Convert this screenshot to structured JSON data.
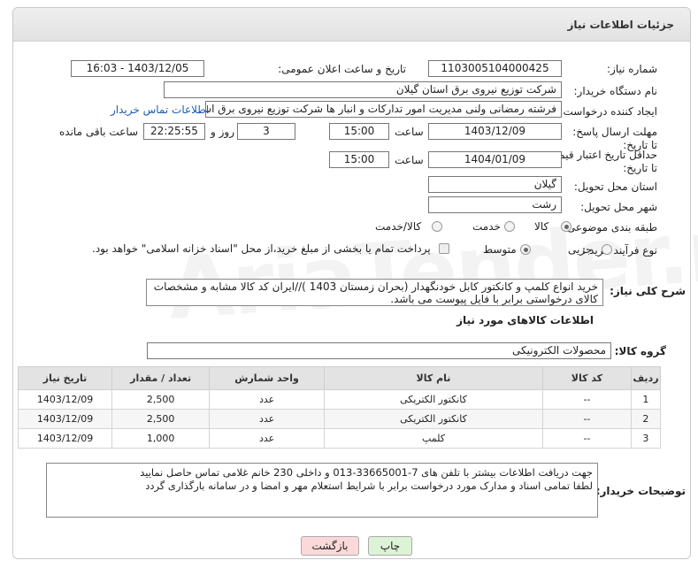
{
  "header": {
    "title": "جزئیات اطلاعات نیاز"
  },
  "form": {
    "need_number_label": "شماره نیاز:",
    "need_number": "1103005104000425",
    "announce_label": "تاریخ و ساعت اعلان عمومی:",
    "announce_value": "1403/12/05 - 16:03",
    "buyer_label": "نام دستگاه خریدار:",
    "buyer_value": "شرکت توزیع نیروی برق استان گیلان",
    "creator_label": "ایجاد کننده درخواست:",
    "creator_value": "فرشته رمضانی ولنی مدیریت امور تدارکات و انبار ها شرکت توزیع نیروی برق استان گیلان",
    "contact_link": "اطلاعات تماس خریدار",
    "deadline_label": "مهلت ارسال پاسخ: تا تاریخ:",
    "deadline_date": "1403/12/09",
    "time_label": "ساعت",
    "deadline_time": "15:00",
    "days_value": "3",
    "days_label": "روز و",
    "remaining_value": "22:25:55",
    "remaining_label": "ساعت باقی مانده",
    "validity_label": "حداقل تاریخ اعتبار قیمت: تا تاریخ:",
    "validity_date": "1404/01/09",
    "validity_time": "15:00",
    "province_label": "استان محل تحویل:",
    "province_value": "گیلان",
    "city_label": "شهر محل تحویل:",
    "city_value": "رشت",
    "category_label": "طبقه بندی موضوعی:",
    "category_options": [
      "کالا",
      "خدمت",
      "کالا/خدمت"
    ],
    "category_selected": "کالا",
    "process_label": "نوع فرآیند خرید :",
    "process_options": [
      "جزیی",
      "متوسط"
    ],
    "process_selected": "متوسط",
    "payment_note": "پرداخت تمام یا بخشی از مبلغ خرید،از محل \"اسناد خزانه اسلامی\" خواهد بود."
  },
  "description": {
    "label": "شرح کلی نیاز:",
    "text": "خرید انواع کلمپ و کانکتور کابل خودنگهدار (بحران زمستان 1403 )//ایران کد کالا مشابه و مشخصات کالای درخواستی برابر با فایل پیوست می باشد."
  },
  "goods": {
    "section_title": "اطلاعات کالاهای مورد نیاز",
    "group_label": "گروه کالا:",
    "group_value": "محصولات الکترونیکی",
    "columns": [
      "ردیف",
      "کد کالا",
      "نام کالا",
      "واحد شمارش",
      "تعداد / مقدار",
      "تاریخ نیاز"
    ],
    "rows": [
      {
        "row": "1",
        "code": "--",
        "name": "کانکتور الکتریکی",
        "unit": "عدد",
        "qty": "2,500",
        "date": "1403/12/09"
      },
      {
        "row": "2",
        "code": "--",
        "name": "کانکتور الکتریکی",
        "unit": "عدد",
        "qty": "2,500",
        "date": "1403/12/09"
      },
      {
        "row": "3",
        "code": "--",
        "name": "کلمپ",
        "unit": "عدد",
        "qty": "1,000",
        "date": "1403/12/09"
      }
    ]
  },
  "notes": {
    "label": "توضیحات خریدار:",
    "line1": "جهت دریافت اطلاعات بیشتر با تلفن های 7-33665001-013 و داخلی 230 خانم غلامی تماس حاصل نمایید",
    "line2": "لطفا تمامی اسناد و مدارک مورد درخواست برابر با شرایط استعلام مهر و امضا و در سامانه بارگذاری گردد"
  },
  "buttons": {
    "print": "چاپ",
    "back": "بازگشت"
  },
  "colors": {
    "back_button": "#fcd9d9",
    "print_button": "#dcf3d6",
    "link": "#1a5cb0"
  }
}
